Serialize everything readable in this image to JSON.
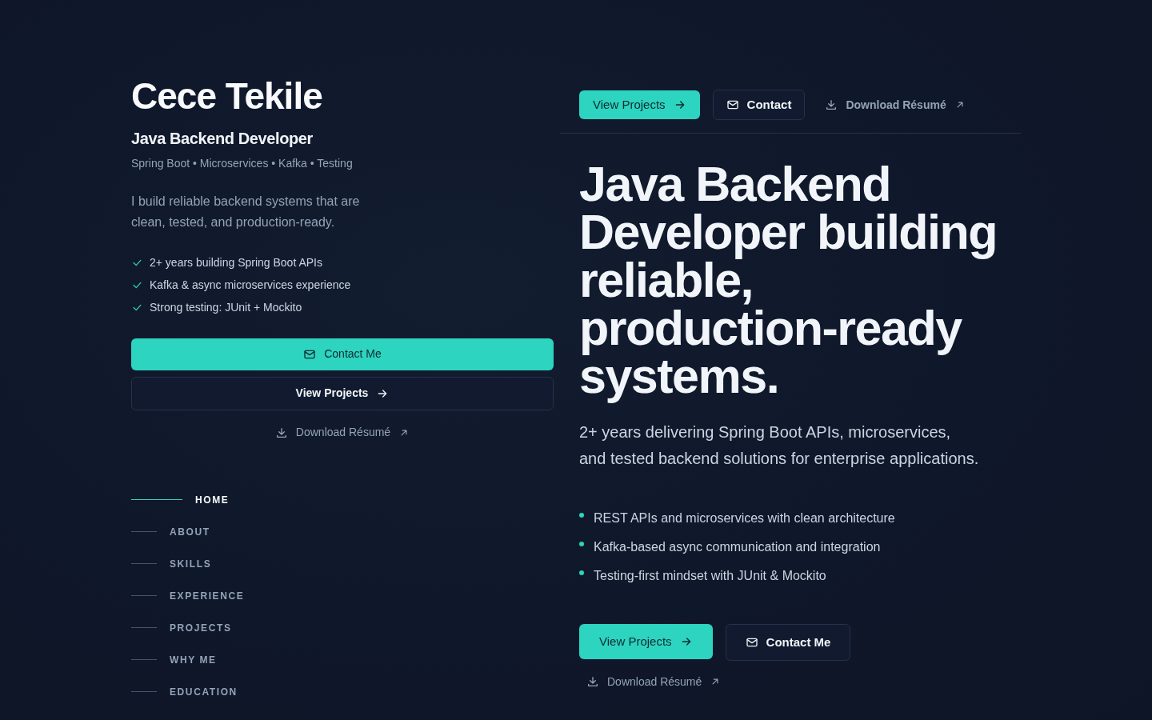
{
  "profile": {
    "name": "Cece Tekile",
    "role": "Java Backend Developer",
    "stack": "Spring Boot • Microservices • Kafka • Testing",
    "intro": "I build reliable backend systems that are clean, tested, and production-ready.",
    "highlights": [
      "2+ years building Spring Boot APIs",
      "Kafka & async microservices experience",
      "Strong testing: JUnit + Mockito"
    ],
    "buttons": [
      {
        "label": "Contact Me",
        "kind": "contact"
      },
      {
        "label": "View Projects",
        "kind": "projects"
      },
      {
        "label": "Download Résumé",
        "kind": "resume"
      }
    ]
  },
  "nav": [
    {
      "label": "HOME",
      "selected": true
    },
    {
      "label": "ABOUT",
      "selected": false
    },
    {
      "label": "SKILLS",
      "selected": false
    },
    {
      "label": "EXPERIENCE",
      "selected": false
    },
    {
      "label": "PROJECTS",
      "selected": false
    },
    {
      "label": "WHY ME",
      "selected": false
    },
    {
      "label": "EDUCATION",
      "selected": false
    }
  ],
  "header_buttons": [
    {
      "label": "View Projects",
      "kind": "projects"
    },
    {
      "label": "Contact",
      "kind": "contact"
    },
    {
      "label": "Download Résumé",
      "kind": "resume"
    }
  ],
  "hero": {
    "headline": "Java Backend Developer building reliable, production-ready systems.",
    "summary": "2+ years delivering Spring Boot APIs, microservices, and tested backend solutions for enterprise applications.",
    "points": [
      "REST APIs and microservices with clean architecture",
      "Kafka-based async communication and integration",
      "Testing-first mindset with JUnit & Mockito"
    ],
    "buttons": [
      {
        "label": "View Projects",
        "kind": "projects"
      },
      {
        "label": "Contact Me",
        "kind": "contact"
      }
    ],
    "link": {
      "label": "Download Résumé",
      "kind": "resume"
    }
  }
}
